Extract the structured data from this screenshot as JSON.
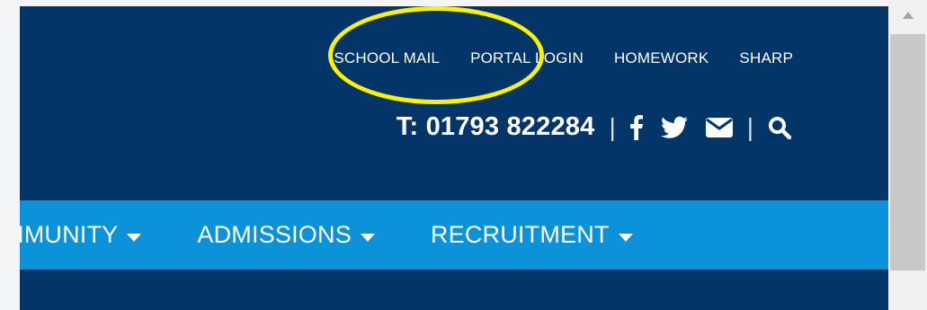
{
  "top_links": [
    "SCHOOL MAIL",
    "PORTAL LOGIN",
    "HOMEWORK",
    "SHARP"
  ],
  "contact": {
    "phone": "T: 01793 822284",
    "separator": "|",
    "icons": [
      "facebook-icon",
      "twitter-icon",
      "envelope-icon",
      "search-icon"
    ]
  },
  "nav": {
    "items": [
      "MMUNITY",
      "ADMISSIONS",
      "RECRUITMENT"
    ]
  },
  "colors": {
    "header_bg": "#033568",
    "nav_bg": "#0b92d8",
    "highlight": "#fff200"
  }
}
